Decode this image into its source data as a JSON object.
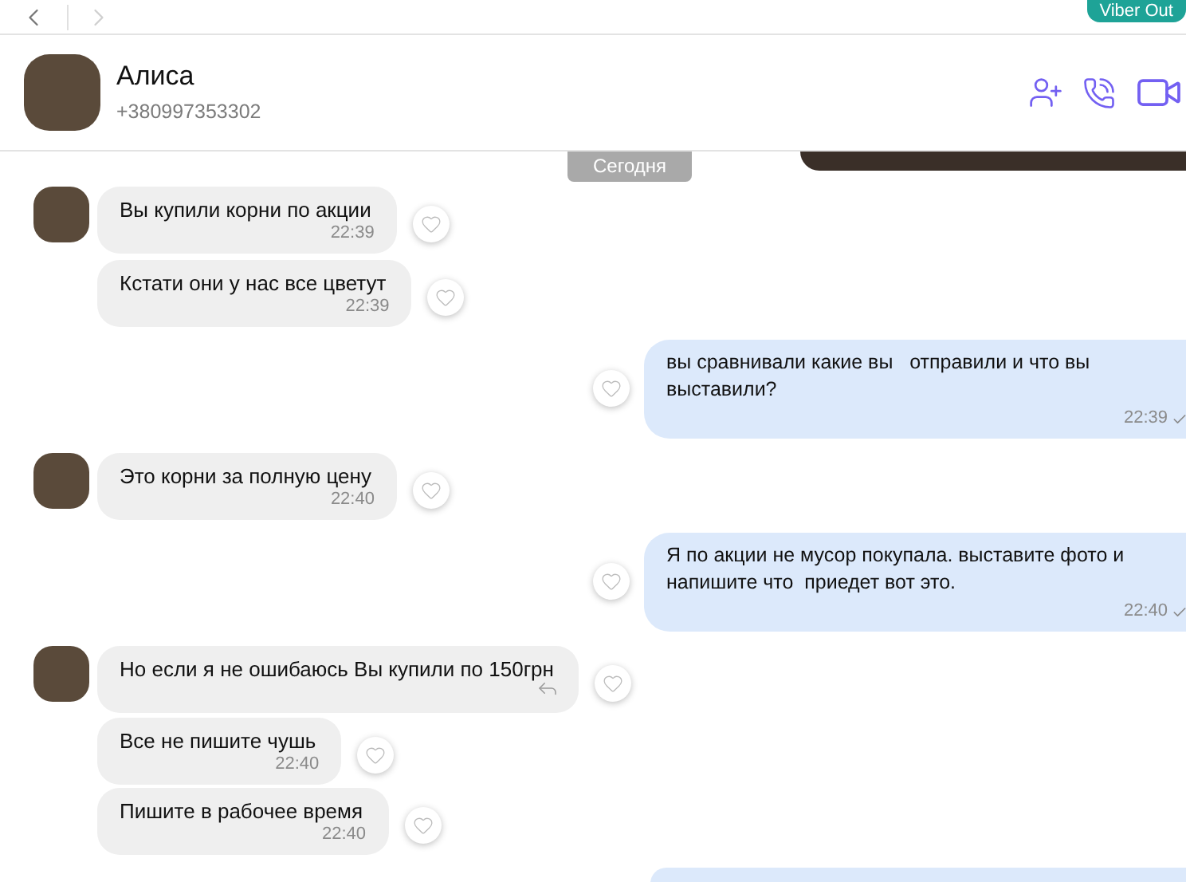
{
  "top_bar": {
    "viber_out_button": "Viber Out"
  },
  "contact": {
    "name": "Алиса",
    "phone": "+380997353302"
  },
  "date_label": "Сегодня",
  "messages": [
    {
      "kind": "incoming",
      "show_avatar": true,
      "text": "Вы купили корни по акции",
      "time": "22:39"
    },
    {
      "kind": "incoming",
      "show_avatar": false,
      "text": "Кстати они у нас все цветут",
      "time": "22:39"
    },
    {
      "kind": "outgoing",
      "text": "вы сравнивали какие вы   отправили и что вы выставили?",
      "time": "22:39"
    },
    {
      "kind": "incoming",
      "show_avatar": true,
      "text": "Это корни за полную цену",
      "time": "22:40"
    },
    {
      "kind": "outgoing",
      "text": "Я по акции не мусор покупала. выставите фото и напишите что  приедет вот это.",
      "time": "22:40"
    },
    {
      "kind": "incoming",
      "show_avatar": true,
      "text": "Но если я не ошибаюсь Вы купили по 150грн",
      "forward": true
    },
    {
      "kind": "incoming",
      "show_avatar": false,
      "text": "Все не пишите чушь",
      "time": "22:40"
    },
    {
      "kind": "incoming",
      "show_avatar": false,
      "text": "Пишите в рабочее время",
      "time": "22:40"
    }
  ]
}
